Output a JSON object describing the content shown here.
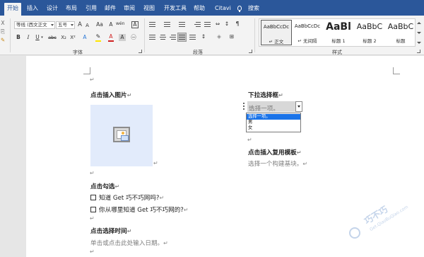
{
  "tabs": [
    "开始",
    "插入",
    "设计",
    "布局",
    "引用",
    "邮件",
    "审阅",
    "视图",
    "开发工具",
    "帮助",
    "Citavi",
    "搜索"
  ],
  "active_tab": "开始",
  "ribbon": {
    "font": {
      "group_label": "字体",
      "font_name": "等线 (西文正文",
      "font_size": "五号",
      "grow_label": "A",
      "shrink_label": "A",
      "case_label": "Aa",
      "clear_label": "A",
      "phonetic_label": "wén",
      "border_char_label": "A",
      "bold": "B",
      "italic": "I",
      "underline": "U",
      "strike": "abc",
      "sub": "X₂",
      "sup": "X²",
      "effects": "A",
      "font_color": "A",
      "char_shade": "A",
      "enclose": "㊀"
    },
    "paragraph": {
      "group_label": "段落"
    },
    "styles": {
      "group_label": "样式",
      "items": [
        {
          "preview": "AaBbCcDc",
          "name": "↵ 正文"
        },
        {
          "preview": "AaBbCcDc",
          "name": "↵ 无间隔"
        },
        {
          "preview": "AaBl",
          "name": "标题 1"
        },
        {
          "preview": "AaBbC",
          "name": "标题 2"
        },
        {
          "preview": "AaBbC",
          "name": "标题"
        }
      ]
    },
    "left_icons": [
      "X",
      "⎘",
      "✎"
    ]
  },
  "document": {
    "insert_image_title": "点击插入图片",
    "dropdown_title": "下拉选择框",
    "dropdown_value": "选择一项。",
    "dropdown_options": [
      "选择一项。",
      "男",
      "女"
    ],
    "reuse_title": "点击插入复用模板",
    "reuse_placeholder": "选择一个构建基块。",
    "check_title": "点击勾选",
    "check_items": [
      "知道 Get 巧不巧网吗?",
      "你从哪里知道 Get 巧不巧网的?"
    ],
    "date_title": "点击选择时间",
    "date_placeholder": "单击或点击此处输入日期。",
    "para_mark": "↵"
  },
  "watermark": {
    "name": "巧不巧",
    "url": "Get.QiaoBuQiao.com"
  },
  "colors": {
    "tabbar": "#2b579a",
    "ribbon": "#f3f3f3",
    "highlight": "#1a73e8",
    "placeholder": "#7f7f7f"
  }
}
